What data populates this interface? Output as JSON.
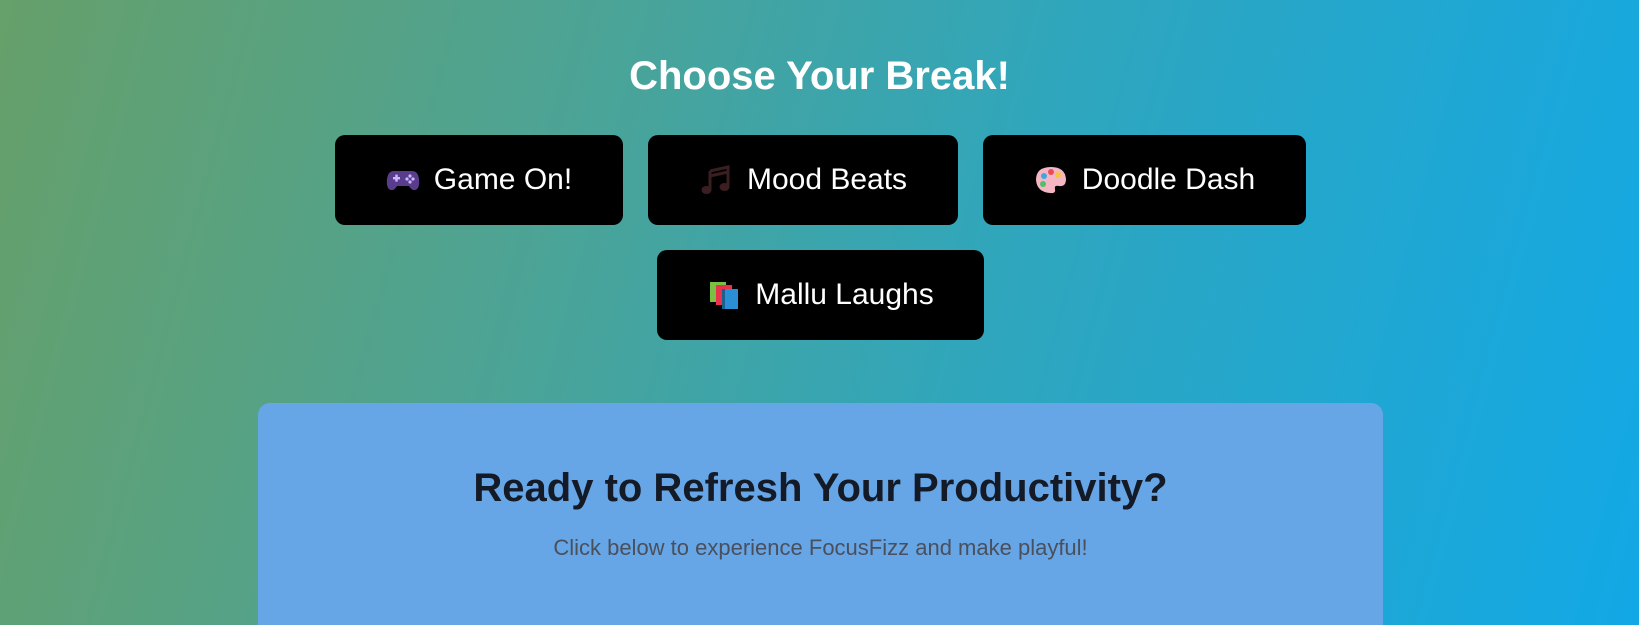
{
  "header": {
    "title": "Choose Your Break!"
  },
  "buttons": [
    {
      "label": "Game On!",
      "icon": "game-controller-icon"
    },
    {
      "label": "Mood Beats",
      "icon": "music-notes-icon"
    },
    {
      "label": "Doodle Dash",
      "icon": "palette-icon"
    },
    {
      "label": "Mallu Laughs",
      "icon": "books-icon"
    }
  ],
  "cta": {
    "heading": "Ready to Refresh Your Productivity?",
    "subtext": "Click below to experience FocusFizz and make playful!"
  },
  "colors": {
    "button_bg": "#000000",
    "button_text": "#ffffff",
    "cta_bg": "#67a6e6",
    "gradient_start": "#66a06a",
    "gradient_end": "#12a8e6"
  }
}
